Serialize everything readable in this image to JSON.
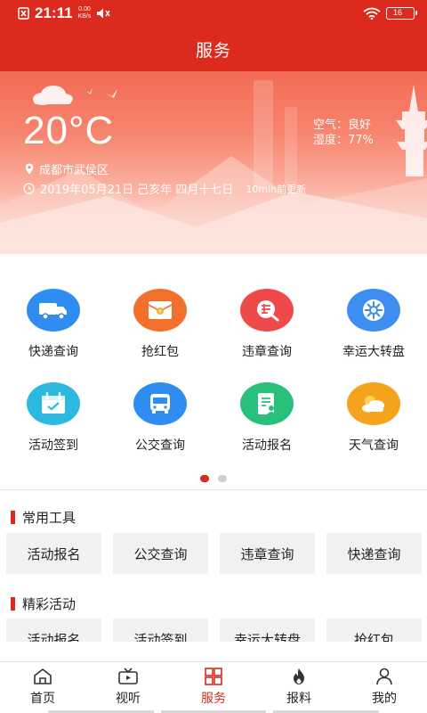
{
  "status_bar": {
    "time": "21:11",
    "net_speed": "0.00",
    "net_unit": "KB/s",
    "battery": "16"
  },
  "header": {
    "title": "服务"
  },
  "weather": {
    "temperature": "20°C",
    "air_label": "空气：良好",
    "humidity_label": "湿度：77%",
    "location": "成都市武侯区",
    "date": "2019年05月21日 己亥年 四月十七日",
    "update": "10min前更新"
  },
  "services": [
    [
      {
        "label": "快递查询",
        "icon": "truck-icon",
        "color": "#2f8df2"
      },
      {
        "label": "抢红包",
        "icon": "red-envelope-icon",
        "color": "#f2702c"
      },
      {
        "label": "违章查询",
        "icon": "violation-icon",
        "color": "#ee4a4a"
      },
      {
        "label": "幸运大转盘",
        "icon": "wheel-icon",
        "color": "#3d8ef0"
      }
    ],
    [
      {
        "label": "活动签到",
        "icon": "calendar-check-icon",
        "color": "#2cb9e0"
      },
      {
        "label": "公交查询",
        "icon": "bus-icon",
        "color": "#2f8df2"
      },
      {
        "label": "活动报名",
        "icon": "signup-form-icon",
        "color": "#28c07a"
      },
      {
        "label": "天气查询",
        "icon": "weather-cloud-icon",
        "color": "#f5a21c"
      }
    ]
  ],
  "tools_section": {
    "title": "常用工具",
    "items": [
      "活动报名",
      "公交查询",
      "违章查询",
      "快递查询"
    ]
  },
  "activities_section": {
    "title": "精彩活动",
    "items": [
      "活动报名",
      "活动签到",
      "幸运大转盘",
      "抢红包"
    ]
  },
  "bottom_nav": [
    {
      "label": "首页",
      "icon": "home-icon",
      "active": false
    },
    {
      "label": "视听",
      "icon": "tv-icon",
      "active": false
    },
    {
      "label": "服务",
      "icon": "grid-icon",
      "active": true
    },
    {
      "label": "报料",
      "icon": "fire-icon",
      "active": false
    },
    {
      "label": "我的",
      "icon": "user-icon",
      "active": false
    }
  ],
  "colors": {
    "brand_red": "#dc2a1e"
  }
}
